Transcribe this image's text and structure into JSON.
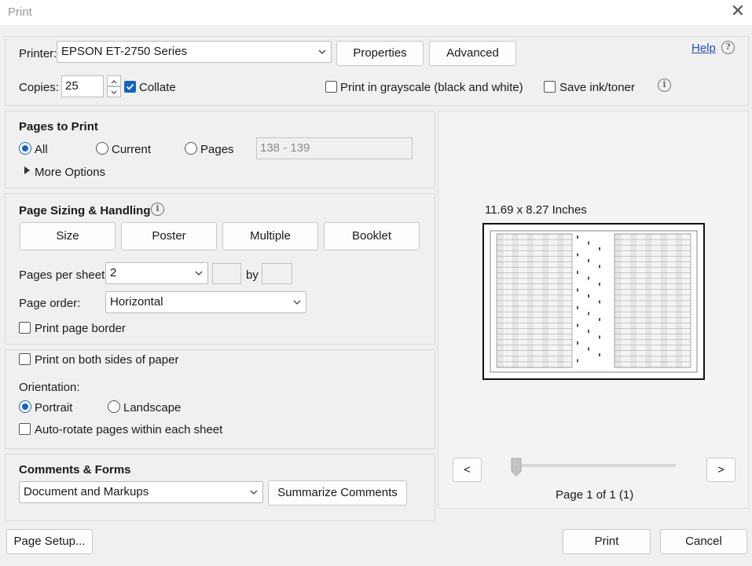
{
  "window": {
    "title": "Print",
    "close_symbol": "✕"
  },
  "top": {
    "printer_label": "Printer:",
    "printer_value": "EPSON ET-2750 Series",
    "properties_label": "Properties",
    "advanced_label": "Advanced",
    "help_label": "Help",
    "help_symbol": "?",
    "copies_label": "Copies:",
    "copies_value": "25",
    "collate_label": "Collate",
    "collate_checked": true,
    "grayscale_label": "Print in grayscale (black and white)",
    "grayscale_checked": false,
    "save_ink_label": "Save ink/toner",
    "save_ink_checked": false,
    "info_symbol": "i"
  },
  "pages_to_print": {
    "heading": "Pages to Print",
    "all_label": "All",
    "current_label": "Current",
    "pages_label": "Pages",
    "pages_range_value": "138 - 139",
    "selected": "All",
    "more_options_label": "More Options"
  },
  "sizing": {
    "heading": "Page Sizing & Handling",
    "info_symbol": "i",
    "buttons": [
      "Size",
      "Poster",
      "Multiple",
      "Booklet"
    ],
    "pages_per_sheet_label": "Pages per sheet:",
    "pages_per_sheet_value": "2",
    "by_label": "by",
    "page_order_label": "Page order:",
    "page_order_value": "Horizontal",
    "print_border_label": "Print page border",
    "print_border_checked": false
  },
  "orientation_section": {
    "both_sides_label": "Print on both sides of paper",
    "both_sides_checked": false,
    "orientation_label": "Orientation:",
    "portrait_label": "Portrait",
    "landscape_label": "Landscape",
    "selected": "Portrait",
    "auto_rotate_label": "Auto-rotate pages within each sheet",
    "auto_rotate_checked": false
  },
  "comments": {
    "heading": "Comments & Forms",
    "value": "Document and Markups",
    "summarize_label": "Summarize Comments"
  },
  "preview": {
    "size_label": "11.69 x 8.27 Inches",
    "prev_label": "<",
    "next_label": ">",
    "page_label": "Page 1 of 1 (1)",
    "slider_position": 0
  },
  "footer": {
    "page_setup_label": "Page Setup...",
    "print_label": "Print",
    "cancel_label": "Cancel"
  },
  "colors": {
    "accent": "#1565c0",
    "link": "#1f4fbf"
  }
}
